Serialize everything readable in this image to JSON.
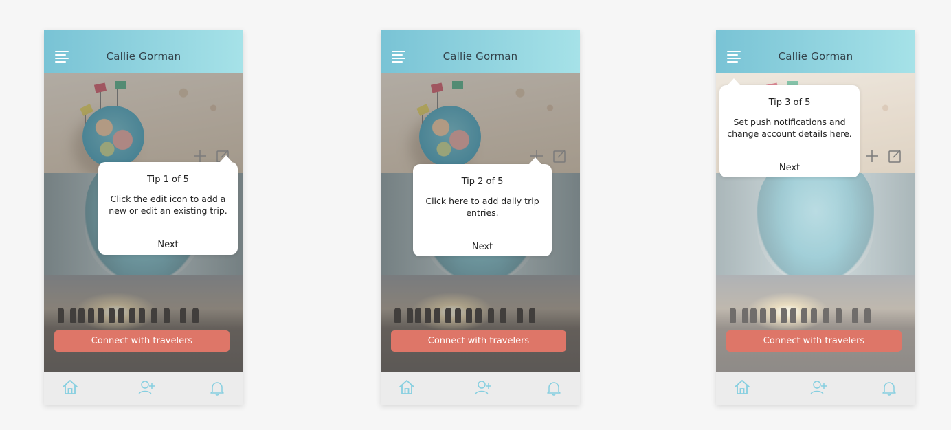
{
  "screens": [
    {
      "header_title": "Callie Gorman",
      "cta_label": "Connect with travelers",
      "tooltip": {
        "title": "Tip 1 of 5",
        "body": "Click the edit icon to add a new or edit an existing trip.",
        "next_label": "Next"
      },
      "tabs": [
        "home-icon",
        "add-person-icon",
        "bell-icon"
      ]
    },
    {
      "header_title": "Callie Gorman",
      "cta_label": "Connect with travelers",
      "tooltip": {
        "title": "Tip 2 of 5",
        "body": "Click here to add daily trip entries.",
        "next_label": "Next"
      },
      "tabs": [
        "home-icon",
        "add-person-icon",
        "bell-icon"
      ]
    },
    {
      "header_title": "Callie Gorman",
      "cta_label": "Connect with travelers",
      "tooltip": {
        "title": "Tip 3 of 5",
        "body": "Set push notifications and change account details here.",
        "next_label": "Next"
      },
      "tabs": [
        "home-icon",
        "add-person-icon",
        "bell-icon"
      ]
    }
  ],
  "colors": {
    "header_gradient_start": "#79c3d5",
    "header_gradient_end": "#a6e2e8",
    "cta": "#de7668",
    "tab_icon": "#86cfe0",
    "tabbar_bg": "#ececec"
  }
}
